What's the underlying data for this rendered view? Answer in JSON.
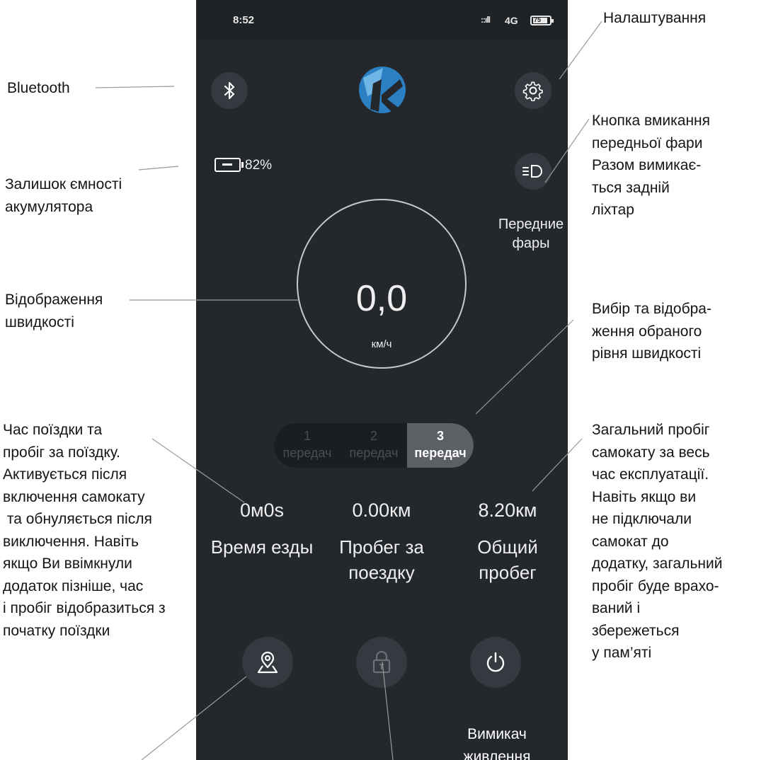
{
  "status_bar": {
    "time": "8:52",
    "network": "4G",
    "battery_level": "75"
  },
  "app": {
    "logo_letter": "K",
    "battery_percent": "82%",
    "headlight_label_line1": "Передние",
    "headlight_label_line2": "фары",
    "speed_value": "0,0",
    "speed_unit": "км/ч",
    "gears": [
      {
        "number": "1",
        "label": "передач",
        "active": false
      },
      {
        "number": "2",
        "label": "передач",
        "active": false
      },
      {
        "number": "3",
        "label": "передач",
        "active": true
      }
    ],
    "stats": [
      {
        "value": "0м0s",
        "label_line1": "Время езды",
        "label_line2": ""
      },
      {
        "value": "0.00км",
        "label_line1": "Пробег за",
        "label_line2": "поездку"
      },
      {
        "value": "8.20км",
        "label_line1": "Общий",
        "label_line2": "пробег"
      }
    ]
  },
  "annotations": {
    "bluetooth": "Bluetooth",
    "settings": "Налаштування",
    "battery": "Залишок ємності\nакумулятора",
    "headlight": "Кнопка вмикання\nпередньої фари\nРазом вимикає-\nться задній\nліхтар",
    "speed": "Відображення\nшвидкості",
    "gear_select": "Вибір та відобра-\nження обраного\nрівня швидкості",
    "trip": "Час поїздки та\nпробіг за поїздку.\nАктивується після\nвключення самокату\n та обнуляється після\nвиключення. Навіть\nякщо Ви ввімкнули\nдодаток пізніше, час\nі пробіг відобразиться з\nпочатку поїздки",
    "total": "Загальний пробіг\nсамокату за весь\nчас експлуатації.\nНавіть якщо ви\nне підключали\nсамокат до\nдодатку, загальний\nпробіг буде врахо-\nваний і\nзбережеться\nу пам’яті",
    "power": "Вимикач\nживлення"
  },
  "icons": [
    "bluetooth-icon",
    "gear-settings-icon",
    "battery-icon",
    "headlight-icon",
    "map-pin-icon",
    "lock-icon",
    "power-icon"
  ],
  "colors": {
    "app_background": "#24282c",
    "button": "#343a40",
    "logo_blue": "#2b7fc3",
    "logo_light": "#6fb6e6"
  }
}
